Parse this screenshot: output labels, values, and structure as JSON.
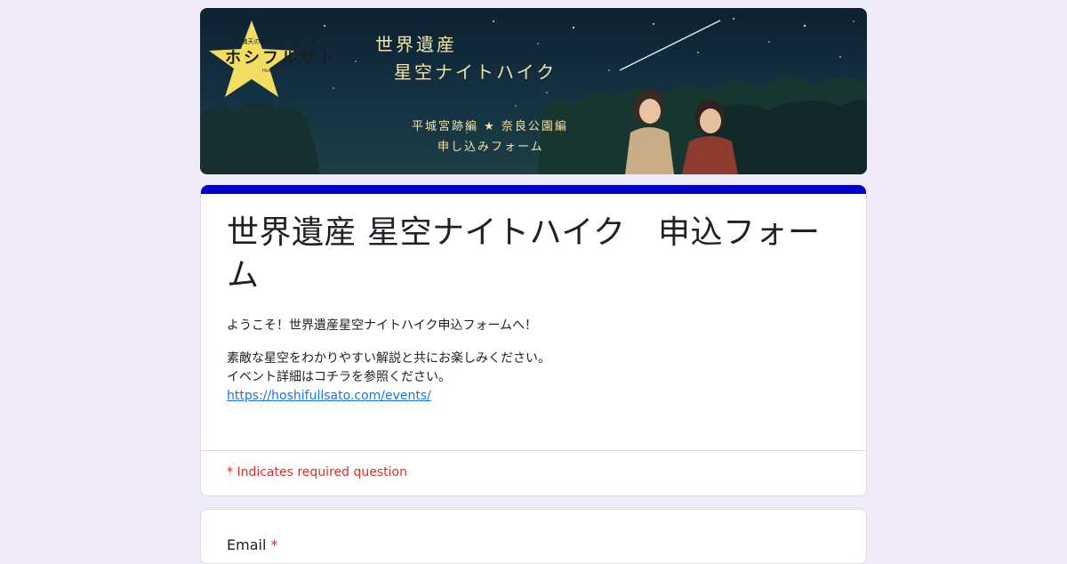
{
  "banner": {
    "logo_tagline": "★ 満天の星空、届くおいで ★",
    "logo_text": "ホシフルサト",
    "logo_sub": "Hoshi Fulla Sato",
    "title_line1": "世界遺産",
    "title_line2": "星空ナイトハイク",
    "subtitle_line1": "平城宮跡編 ★ 奈良公園編",
    "subtitle_line2": "申し込みフォーム"
  },
  "form": {
    "title": "世界遺産 星空ナイトハイク　申込フォーム",
    "description_line1": "ようこそ！世界遺産星空ナイトハイク申込フォームへ！",
    "description_line2": "素敵な星空をわかりやすい解説と共にお楽しみください。",
    "description_line3": "イベント詳細はコチラを参照ください。",
    "link_text": "https://hoshifullsato.com/events/",
    "required_note": "* Indicates required question"
  },
  "questions": {
    "email_label": "Email",
    "required_marker": "*"
  },
  "colors": {
    "background": "#f0ebf8",
    "accent": "#0000c7",
    "required": "#d93025",
    "link": "#1a73e8"
  }
}
